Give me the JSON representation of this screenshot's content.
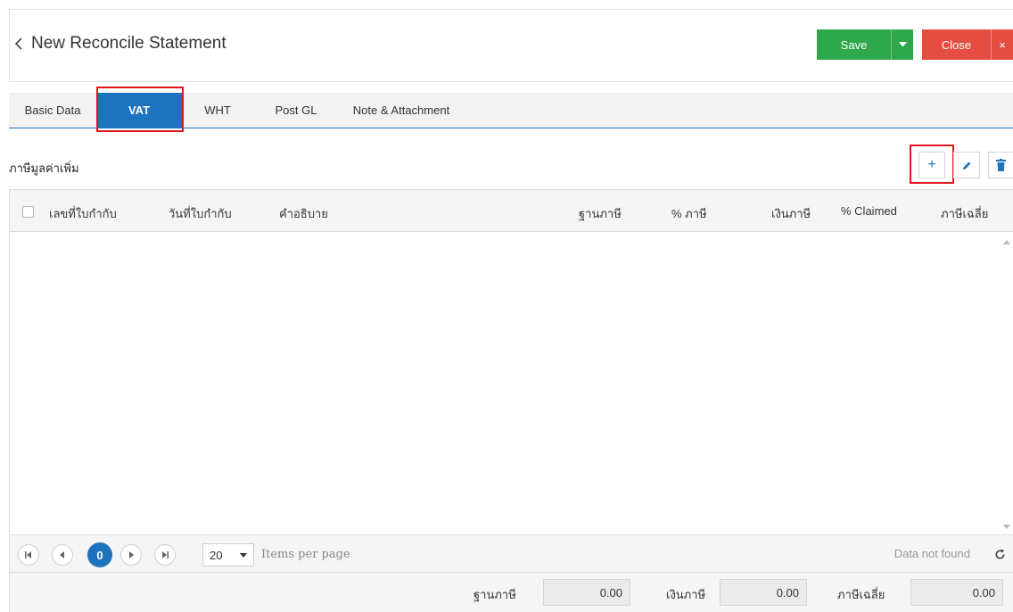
{
  "header": {
    "title": "New Reconcile Statement",
    "save_label": "Save",
    "close_label": "Close",
    "save_color": "#2ea84a",
    "close_color": "#e54d42"
  },
  "tabs": [
    {
      "label": "Basic Data",
      "active": false
    },
    {
      "label": "VAT",
      "active": true
    },
    {
      "label": "WHT",
      "active": false
    },
    {
      "label": "Post GL",
      "active": false
    },
    {
      "label": "Note & Attachment",
      "active": false
    }
  ],
  "section": {
    "title": "ภาษีมูลค่าเพิ่ม",
    "add_label": "+"
  },
  "table": {
    "columns": [
      "เลขที่ใบกำกับ",
      "วันที่ใบกำกับ",
      "คำอธิบาย",
      "ฐานภาษี",
      "% ภาษี",
      "เงินภาษี",
      "% Claimed",
      "ภาษีเฉลี่ย"
    ],
    "rows": []
  },
  "pager": {
    "current_page": "0",
    "page_size": "20",
    "items_per_page_label": "Items per page",
    "status": "Data not found"
  },
  "footer": {
    "tax_base_label": "ฐานภาษี",
    "tax_base_value": "0.00",
    "tax_amount_label": "เงินภาษี",
    "tax_amount_value": "0.00",
    "avg_tax_label": "ภาษีเฉลี่ย",
    "avg_tax_value": "0.00"
  },
  "accent_color": "#1e73be"
}
